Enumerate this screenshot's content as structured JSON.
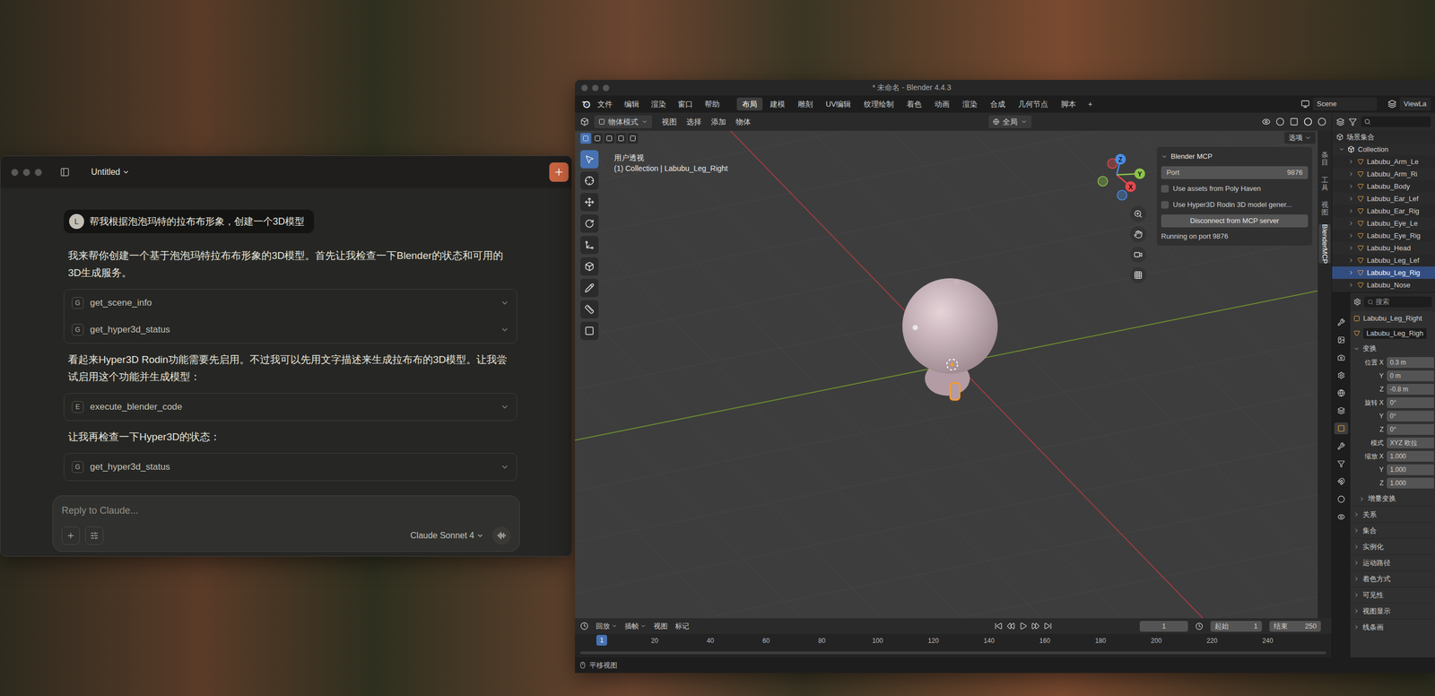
{
  "claude_window": {
    "title": "Untitled",
    "messages": [
      {
        "kind": "user",
        "avatar": "L",
        "text": "帮我根据泡泡玛特的拉布布形象，创建一个3D模型"
      },
      {
        "kind": "text",
        "text": "我来帮你创建一个基于泡泡玛特拉布布形象的3D模型。首先让我检查一下Blender的状态和可用的3D生成服务。"
      },
      {
        "kind": "tools",
        "tools": [
          {
            "icon": "G",
            "name": "get_scene_info"
          },
          {
            "icon": "G",
            "name": "get_hyper3d_status"
          }
        ]
      },
      {
        "kind": "text",
        "text": "看起来Hyper3D Rodin功能需要先启用。不过我可以先用文字描述来生成拉布布的3D模型。让我尝试启用这个功能并生成模型："
      },
      {
        "kind": "tools",
        "tools": [
          {
            "icon": "E",
            "name": "execute_blender_code"
          }
        ]
      },
      {
        "kind": "text",
        "text": "让我再检查一下Hyper3D的状态："
      },
      {
        "kind": "tools",
        "tools": [
          {
            "icon": "G",
            "name": "get_hyper3d_status"
          }
        ]
      }
    ],
    "composer": {
      "placeholder": "Reply to Claude...",
      "model": "Claude Sonnet 4"
    }
  },
  "blender_window": {
    "title": "* 未命名 - Blender 4.4.3",
    "menus": [
      "文件",
      "编辑",
      "渲染",
      "窗口",
      "帮助"
    ],
    "workspaces": [
      {
        "label": "布局",
        "selected": true
      },
      {
        "label": "建模",
        "selected": false
      },
      {
        "label": "雕刻",
        "selected": false
      },
      {
        "label": "UV编辑",
        "selected": false
      },
      {
        "label": "纹理绘制",
        "selected": false
      },
      {
        "label": "着色",
        "selected": false
      },
      {
        "label": "动画",
        "selected": false
      },
      {
        "label": "渲染",
        "selected": false
      },
      {
        "label": "合成",
        "selected": false
      },
      {
        "label": "几何节点",
        "selected": false
      },
      {
        "label": "脚本",
        "selected": false
      }
    ],
    "add_workspace": "+",
    "scene": "Scene",
    "view_layer": "ViewLa",
    "viewport_header": {
      "mode": "物体模式",
      "menus": [
        "视图",
        "选择",
        "添加",
        "物体"
      ],
      "orientation": "全局",
      "options": "选项"
    },
    "viewport": {
      "view_name": "用户透视",
      "context": "(1) Collection | Labubu_Leg_Right",
      "gizmo": [
        {
          "label": "X",
          "color": "#e5484d"
        },
        {
          "label": "Y",
          "color": "#8bc34a"
        },
        {
          "label": "Z",
          "color": "#4a8fe7"
        }
      ]
    },
    "side_tabs": [
      {
        "label": "条目",
        "kind": "cjk",
        "selected": false
      },
      {
        "label": "工具",
        "kind": "cjk",
        "selected": false
      },
      {
        "label": "视图",
        "kind": "cjk",
        "selected": false
      },
      {
        "label": "BlenderMCP",
        "kind": "latin",
        "selected": true
      }
    ],
    "mcp_panel": {
      "title": "Blender MCP",
      "port_label": "Port",
      "port": "9876",
      "options": [
        {
          "label": "Use assets from Poly Haven",
          "checked": false
        },
        {
          "label": "Use Hyper3D Rodin 3D model gener...",
          "checked": false
        }
      ],
      "button": "Disconnect from MCP server",
      "status": "Running on port 9876"
    },
    "outliner": {
      "root": "场景集合",
      "collection": "Collection",
      "items": [
        {
          "label": "Labubu_Arm_Le",
          "selected": false
        },
        {
          "label": "Labubu_Arm_Ri",
          "selected": false
        },
        {
          "label": "Labubu_Body",
          "selected": false
        },
        {
          "label": "Labubu_Ear_Lef",
          "selected": false
        },
        {
          "label": "Labubu_Ear_Rig",
          "selected": false
        },
        {
          "label": "Labubu_Eye_Le",
          "selected": false
        },
        {
          "label": "Labubu_Eye_Rig",
          "selected": false
        },
        {
          "label": "Labubu_Head",
          "selected": false
        },
        {
          "label": "Labubu_Leg_Lef",
          "selected": false
        },
        {
          "label": "Labubu_Leg_Rig",
          "selected": true
        },
        {
          "label": "Labubu_Nose",
          "selected": false
        }
      ]
    },
    "properties": {
      "search": "搜索",
      "object": "Labubu_Leg_Right",
      "data": "Labubu_Leg_Righ",
      "section": "变换",
      "rows": [
        {
          "label": "位置 X",
          "value": "0.3 m"
        },
        {
          "label": "Y",
          "value": "0 m"
        },
        {
          "label": "Z",
          "value": "-0.8 m"
        },
        {
          "label": "旋转 X",
          "value": "0°"
        },
        {
          "label": "Y",
          "value": "0°"
        },
        {
          "label": "Z",
          "value": "0°"
        },
        {
          "label": "模式",
          "value": "XYZ 欧拉"
        },
        {
          "label": "缩放 X",
          "value": "1.000"
        },
        {
          "label": "Y",
          "value": "1.000"
        },
        {
          "label": "Z",
          "value": "1.000"
        }
      ],
      "subsection": "增量变换",
      "panels": [
        "关系",
        "集合",
        "实例化",
        "运动路径",
        "着色方式",
        "可见性",
        "视图显示",
        "线条画"
      ]
    },
    "timeline": {
      "menus": [
        "回放",
        "插帧",
        "视图",
        "标记"
      ],
      "current_frame": "1",
      "start_label": "起始",
      "start": "1",
      "end_label": "结束",
      "end": "250",
      "playhead": "1",
      "ticks": [
        "20",
        "40",
        "60",
        "80",
        "100",
        "120",
        "140",
        "160",
        "180",
        "200",
        "220",
        "240"
      ]
    },
    "status_bar": "平移视图"
  }
}
